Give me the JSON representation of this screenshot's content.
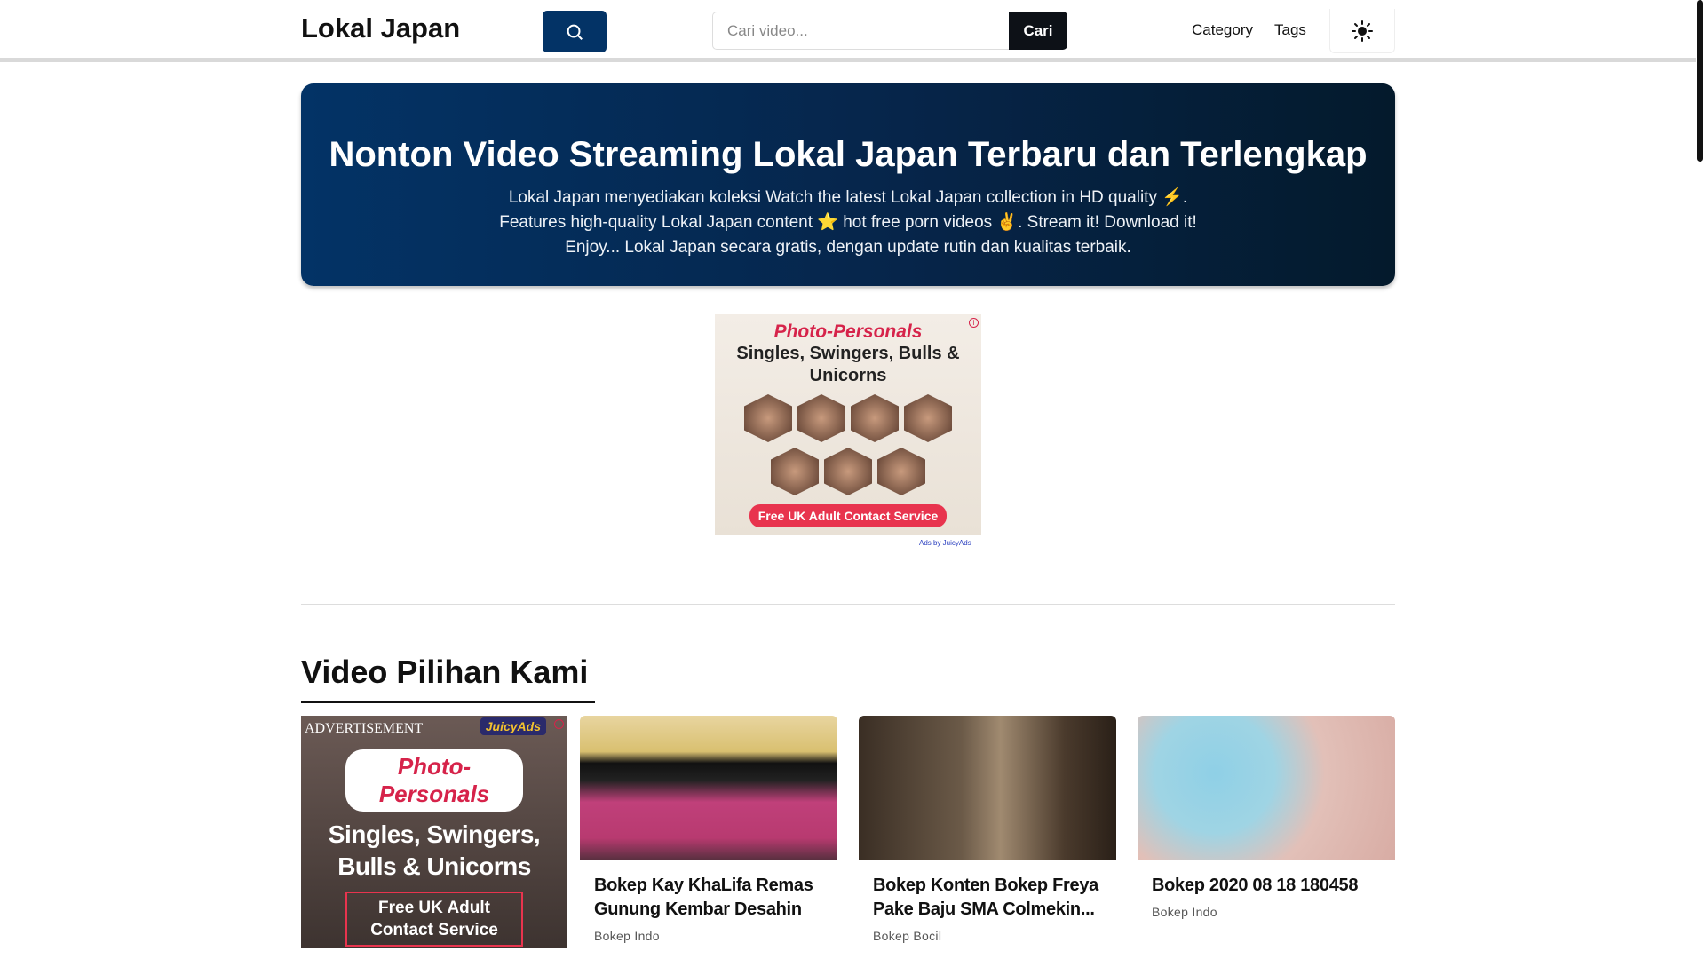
{
  "header": {
    "logo": "Lokal Japan",
    "search_placeholder": "Cari video...",
    "search_button": "Cari",
    "nav": [
      "Category",
      "Tags"
    ]
  },
  "hero": {
    "title": "Nonton Video Streaming Lokal Japan Terbaru dan Terlengkap",
    "lines": [
      "Lokal Japan menyediakan koleksi Watch the latest Lokal Japan collection in HD quality ⚡.",
      "Features high-quality Lokal Japan content ⭐ hot free porn videos ✌️. Stream it! Download it!",
      "Enjoy... Lokal Japan secara gratis, dengan update rutin dan kualitas terbaik."
    ]
  },
  "ad_top": {
    "brand": "Photo-Personals",
    "tagline": "Singles, Swingers, Bulls & Unicorns",
    "cta": "Free UK Adult Contact Service",
    "credit": "Ads by JuicyAds"
  },
  "section": {
    "title": "Video Pilihan Kami"
  },
  "ad_card": {
    "label": "ADVERTISEMENT",
    "network": "JuicyAds",
    "brand": "Photo-Personals",
    "tagline": "Singles, Swingers, Bulls & Unicorns",
    "cta": "Free UK Adult Contact Service"
  },
  "videos": [
    {
      "title": "Bokep Kay KhaLifa Remas Gunung Kembar Desahin",
      "category": "Bokep Indo"
    },
    {
      "title": "Bokep Konten Bokep Freya Pake Baju SMA Colmekin...",
      "category": "Bokep Bocil"
    },
    {
      "title": "Bokep 2020 08 18 180458",
      "category": "Bokep Indo"
    }
  ]
}
